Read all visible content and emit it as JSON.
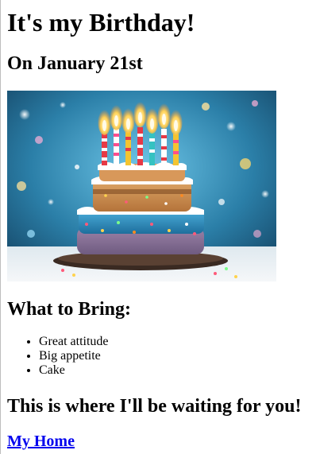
{
  "page": {
    "title": "It's my Birthday!",
    "date_heading": "On January 21st",
    "bring_heading": "What to Bring:",
    "bring_items": [
      {
        "label": "Great attitude"
      },
      {
        "label": "Big appetite"
      },
      {
        "label": "Cake"
      }
    ],
    "waiting_heading": "This is where I'll be waiting for you!",
    "home_link": "My Home"
  },
  "colors": {
    "link": "#0000ee",
    "text": "#000000",
    "background": "#ffffff"
  }
}
